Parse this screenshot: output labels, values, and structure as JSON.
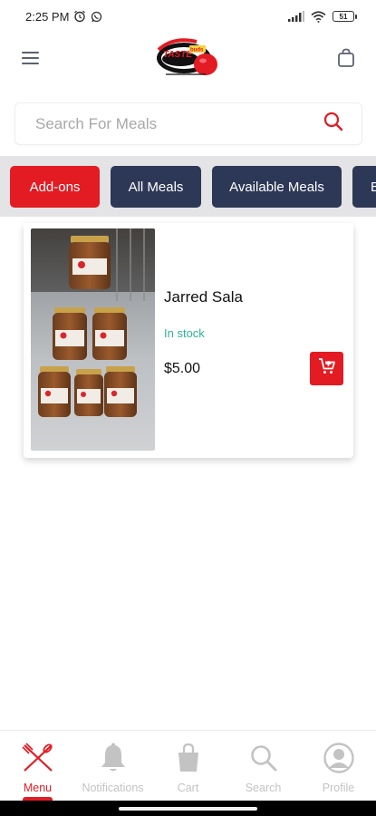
{
  "status_bar": {
    "time": "2:25 PM",
    "battery": "51",
    "icons": [
      "alarm-icon",
      "whatsapp-icon",
      "signal-icon",
      "wifi-icon",
      "battery-icon"
    ]
  },
  "header": {
    "menu_icon": "hamburger-icon",
    "logo_alt": "Taste Buds",
    "bag_icon": "shopping-bag-icon"
  },
  "search": {
    "placeholder": "Search For Meals",
    "value": ""
  },
  "tabs": [
    {
      "label": "Add-ons",
      "active": true
    },
    {
      "label": "All Meals",
      "active": false
    },
    {
      "label": "Available Meals",
      "active": false
    },
    {
      "label": "B",
      "active": false
    }
  ],
  "products": [
    {
      "name": "Jarred Sala",
      "stock": "In stock",
      "price": "$5.00"
    }
  ],
  "bottom_nav": [
    {
      "label": "Menu",
      "icon": "fork-knife-icon",
      "active": true
    },
    {
      "label": "Notifications",
      "icon": "bell-icon",
      "active": false
    },
    {
      "label": "Cart",
      "icon": "bag-icon",
      "active": false
    },
    {
      "label": "Search",
      "icon": "search-icon",
      "active": false
    },
    {
      "label": "Profile",
      "icon": "user-icon",
      "active": false
    }
  ],
  "colors": {
    "accent": "#e31b23",
    "tab_dark": "#2d3856",
    "in_stock": "#2bb396",
    "nav_inactive": "#c3c3c3"
  }
}
